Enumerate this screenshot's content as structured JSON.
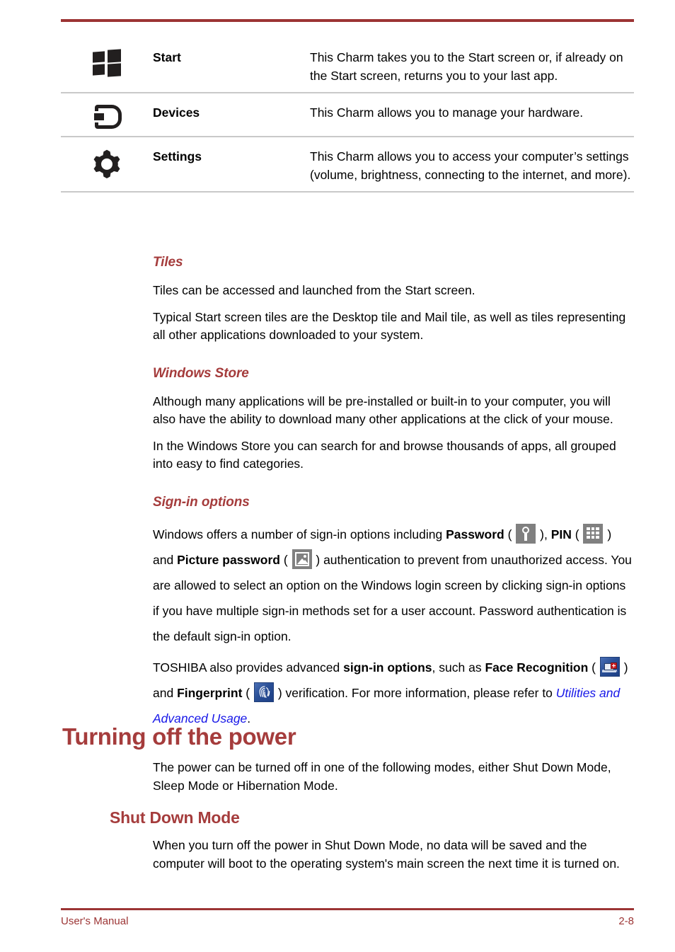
{
  "charms": {
    "rows": [
      {
        "icon": "windows-start-icon",
        "name": "Start",
        "description": "This Charm takes you to the Start screen or, if already on the Start screen, returns you to your last app."
      },
      {
        "icon": "devices-icon",
        "name": "Devices",
        "description": "This Charm allows you to manage your hardware."
      },
      {
        "icon": "settings-gear-icon",
        "name": "Settings",
        "description": "This Charm allows you to access your computer’s settings (volume, brightness, connecting to the internet, and more)."
      }
    ]
  },
  "sections": {
    "tiles": {
      "heading": "Tiles",
      "p1": "Tiles can be accessed and launched from the Start screen.",
      "p2": "Typical Start screen tiles are the Desktop tile and Mail tile, as well as tiles representing all other applications downloaded to your system."
    },
    "windows_store": {
      "heading": "Windows Store",
      "p1": "Although many applications will be pre-installed or built-in to your computer, you will also have the ability to download many other applications at the click of your mouse.",
      "p2": "In the Windows Store you can search for and browse thousands of apps, all grouped into easy to find categories."
    },
    "signin": {
      "heading": "Sign-in options",
      "seg1": "Windows offers a number of sign-in options including ",
      "bold_password": "Password",
      "seg2": " ( ",
      "seg3": " ), ",
      "bold_pin": "PIN",
      "seg4": " ( ",
      "seg5": " ) and ",
      "bold_picture_password": "Picture password",
      "seg6": " ( ",
      "seg7": " ) authentication to prevent from unauthorized access. You are allowed to select an option on the Windows login screen by clicking sign-in options if you have multiple sign-in methods set for a user account. Password authentication is the default sign-in option.",
      "p2_seg1": "TOSHIBA also provides advanced ",
      "p2_bold_signin": "sign-in options",
      "p2_seg2": ", such as ",
      "p2_bold_face": "Face Recognition",
      "p2_seg3": " ( ",
      "p2_seg4": " ) and ",
      "p2_bold_fingerprint": "Fingerprint",
      "p2_seg5": " ( ",
      "p2_seg6": " ) verification. For more information, please refer to ",
      "p2_xref": "Utilities and Advanced Usage",
      "p2_seg7": "."
    },
    "turning_off": {
      "heading": "Turning off the power",
      "p1": "The power can be turned off in one of the following modes, either Shut Down Mode, Sleep Mode or Hibernation Mode."
    },
    "shut_down": {
      "heading": "Shut Down Mode",
      "p1": "When you turn off the power in Shut Down Mode, no data will be saved and the computer will boot to the operating system's main screen the next time it is turned on."
    }
  },
  "icons": {
    "password": "key-icon",
    "pin": "keypad-icon",
    "picture_password": "picture-icon",
    "face_recognition": "toshiba-face-recognition-icon",
    "fingerprint": "fingerprint-icon"
  },
  "footer": {
    "left": "User's Manual",
    "right": "2-8"
  },
  "colors": {
    "heading_red": "#a53c3c",
    "rule_red": "#9c3434",
    "xref_blue": "#1717e8",
    "row_separator": "#c9c9c9"
  }
}
